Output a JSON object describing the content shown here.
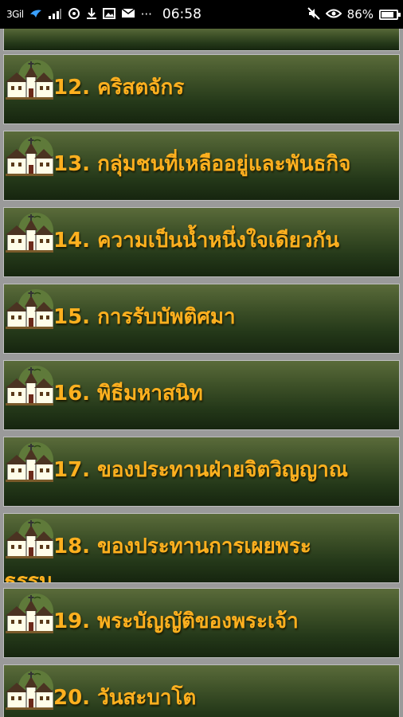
{
  "status_bar": {
    "carrier": "3Gil",
    "time": "06:58",
    "battery_percent": "86%",
    "battery_level": 0.86,
    "icons_left": [
      "signal-icon",
      "bird-app-icon",
      "signal-bars-icon",
      "sync-icon",
      "download-icon",
      "image-icon",
      "mail-icon",
      "more-icon"
    ],
    "icons_right": [
      "mute-icon",
      "eye-icon",
      "battery-icon"
    ]
  },
  "items": [
    {
      "label": ""
    },
    {
      "label": "12. คริสตจักร"
    },
    {
      "label": "13. กลุ่มชนที่เหลืออยู่และพันธกิจ"
    },
    {
      "label": "14. ความเป็นน้ำหนึ่งใจเดียวกัน"
    },
    {
      "label": "15. การรับบัพติศมา"
    },
    {
      "label": "16. พิธีมหาสนิท"
    },
    {
      "label": "17. ของประทานฝ่ายจิตวิญญาณ"
    },
    {
      "label": "18. ของประทานการเผยพระ",
      "overflow": "ธรรม"
    },
    {
      "label": "19. พระบัญญัติของพระเจ้า"
    },
    {
      "label": "20. วันสะบาโต"
    }
  ],
  "colors": {
    "label": "#ffb01f",
    "row_top": "#5a6b3a",
    "row_bottom": "#16250f",
    "divider": "#9a9a9a"
  }
}
